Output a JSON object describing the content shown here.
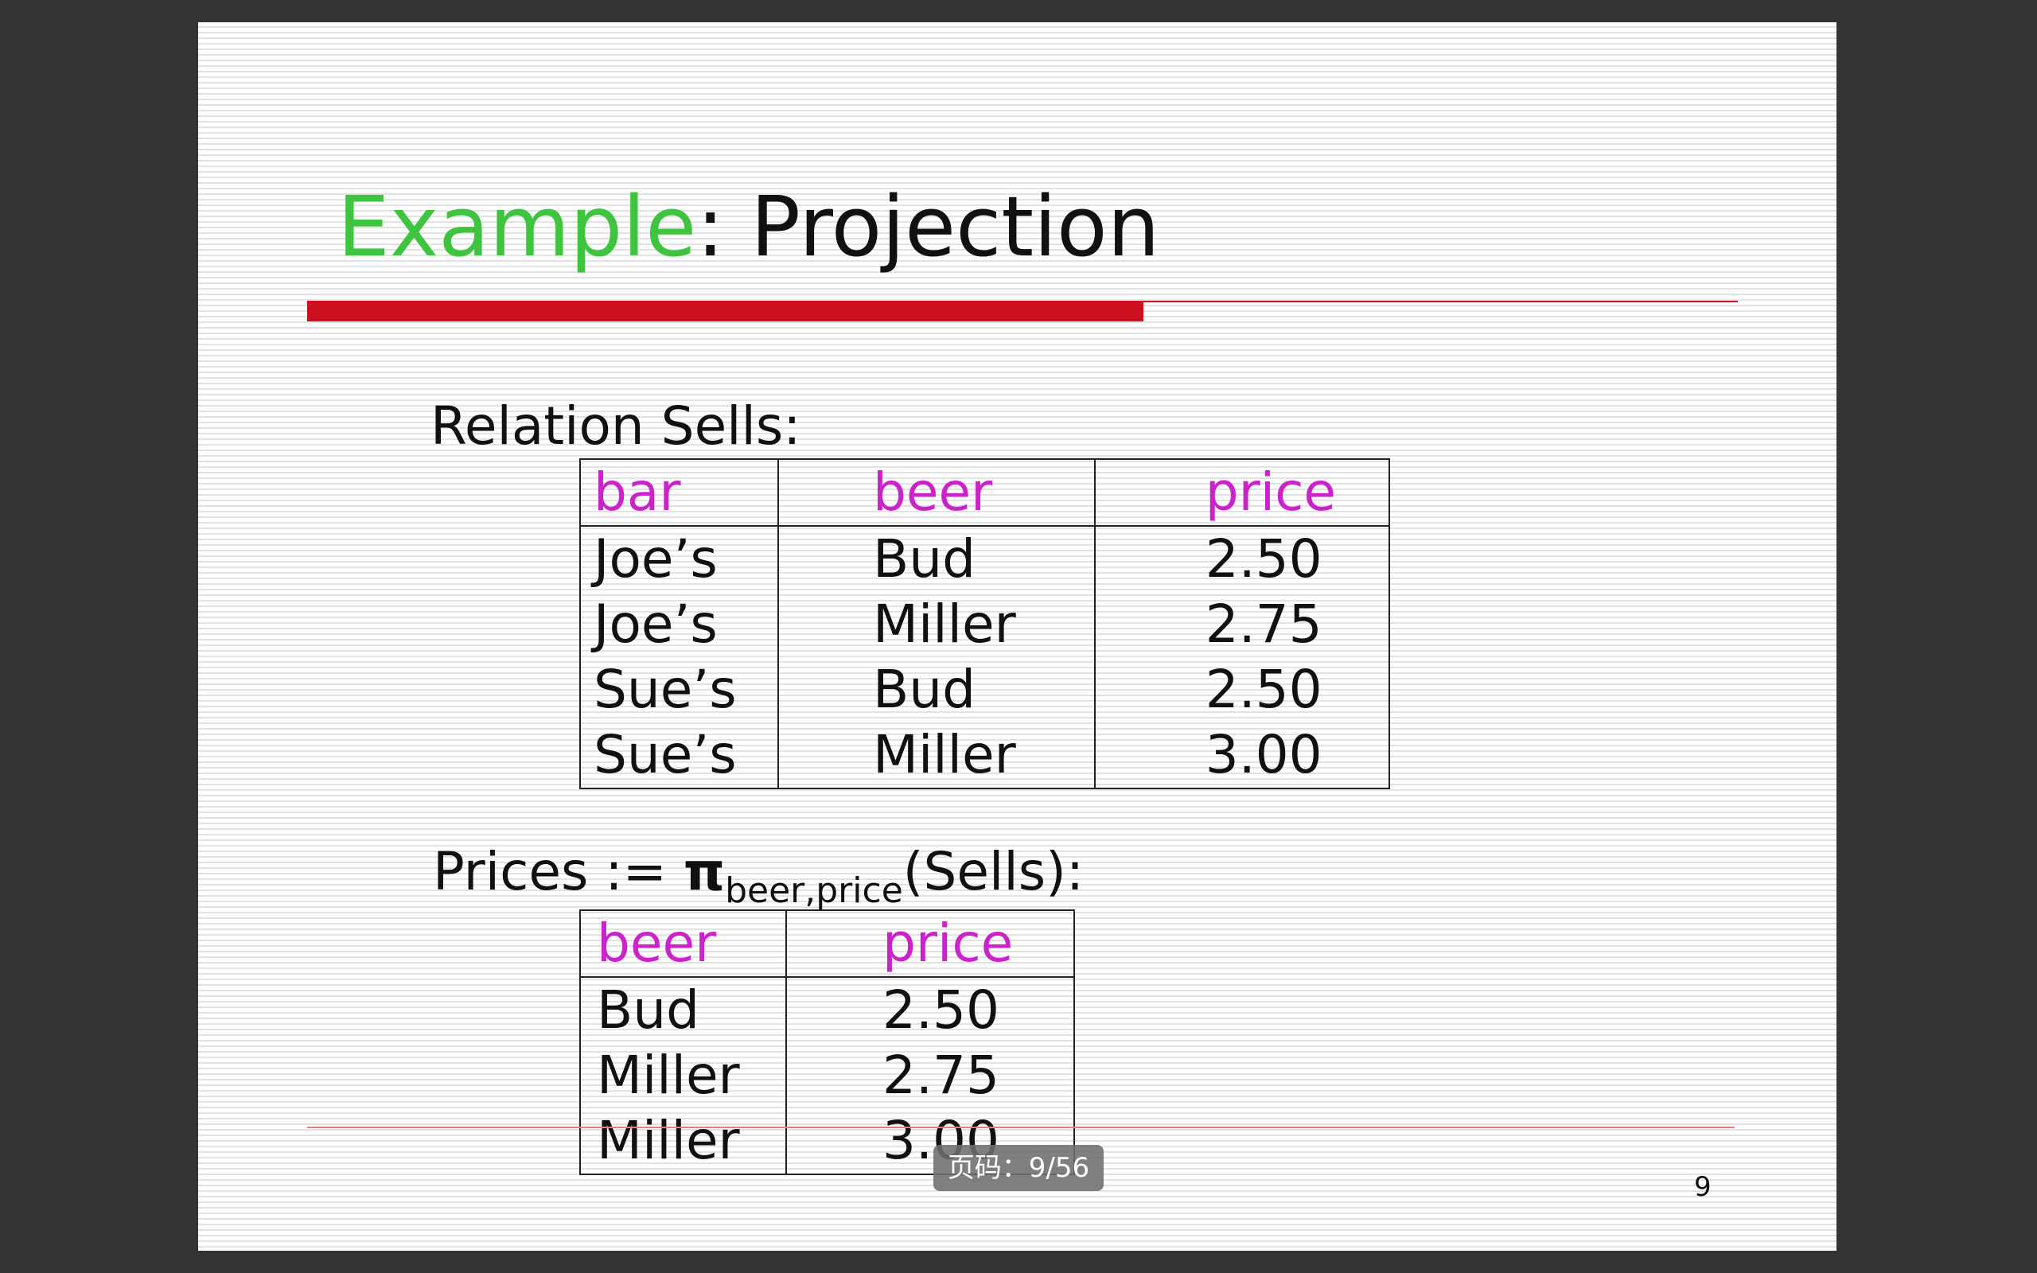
{
  "slide": {
    "title_accent": "Example",
    "title_rest": ": Projection",
    "caption_relation": "Relation Sells:",
    "caption_prices_prefix": "Prices := ",
    "caption_prices_pi": "π",
    "caption_prices_sub": "beer,price",
    "caption_prices_suffix": "(Sells):",
    "page_number": "9"
  },
  "sells_table": {
    "headers": [
      "bar",
      "beer",
      "price"
    ],
    "rows": [
      [
        "Joe’s",
        "Bud",
        "2.50"
      ],
      [
        "Joe’s",
        "Miller",
        "2.75"
      ],
      [
        "Sue’s",
        "Bud",
        "2.50"
      ],
      [
        "Sue’s",
        "Miller",
        "3.00"
      ]
    ]
  },
  "prices_table": {
    "headers": [
      "beer",
      "price"
    ],
    "rows": [
      [
        "Bud",
        "2.50"
      ],
      [
        "Miller",
        "2.75"
      ],
      [
        "Miller",
        "3.00"
      ]
    ]
  },
  "viewer": {
    "pager_label": "页码：9/56"
  },
  "colors": {
    "title_accent": "#3fc43f",
    "header_text": "#cc22cc",
    "rule": "#cc1020",
    "background": "#333333"
  }
}
